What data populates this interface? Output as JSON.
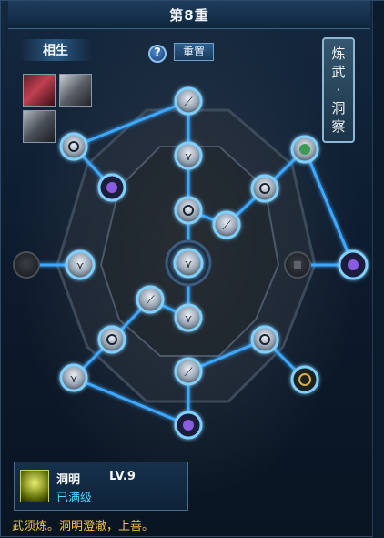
{
  "title": "第8重",
  "tabs": {
    "xiangsheng": "相生"
  },
  "buttons": {
    "help": "?",
    "reset": "重置"
  },
  "side_button": {
    "line1": "炼",
    "line2": "武",
    "line3": "·",
    "line4": "洞",
    "line5": "察"
  },
  "info": {
    "name": "洞明",
    "level": "LV.9",
    "status": "已满级"
  },
  "description": "武须炼。洞明澄澈，上善。",
  "colors": {
    "link": "#3ea8ff",
    "node_ring": "#7fd0ff",
    "desc_text": "#f5c542",
    "status_text": "#4dd4ff"
  },
  "skill_slots": [
    "book-icon",
    "claw-weapon-icon",
    "armor-icon"
  ]
}
